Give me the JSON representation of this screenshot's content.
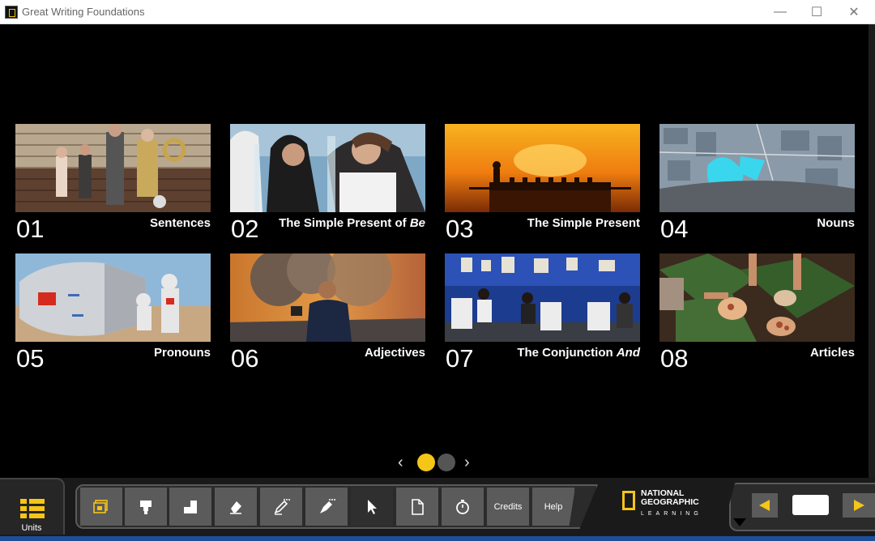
{
  "window": {
    "title": "Great Writing Foundations",
    "minimize_label": "—",
    "maximize_label": "☐",
    "close_label": "✕"
  },
  "units": [
    {
      "number": "01",
      "title": "Sentences",
      "title_italic": ""
    },
    {
      "number": "02",
      "title": "The Simple Present of ",
      "title_italic": "Be"
    },
    {
      "number": "03",
      "title": "The Simple Present",
      "title_italic": ""
    },
    {
      "number": "04",
      "title": "Nouns",
      "title_italic": ""
    },
    {
      "number": "05",
      "title": "Pronouns",
      "title_italic": ""
    },
    {
      "number": "06",
      "title": "Adjectives",
      "title_italic": ""
    },
    {
      "number": "07",
      "title": "The Conjunction ",
      "title_italic": "And"
    },
    {
      "number": "08",
      "title": "Articles",
      "title_italic": ""
    }
  ],
  "pager": {
    "prev": "‹",
    "next": "›",
    "pages": 2,
    "current": 1
  },
  "toolbar": {
    "units_label": "Units",
    "credits_label": "Credits",
    "help_label": "Help",
    "icons": [
      "screens-icon",
      "highlighter-icon",
      "screen-mask-icon",
      "eraser-icon",
      "pencil-icon",
      "pen-icon",
      "pointer-icon",
      "blank-page-icon",
      "timer-icon"
    ]
  },
  "brand": {
    "line1": "NATIONAL",
    "line2": "GEOGRAPHIC",
    "line3": "LEARNING"
  },
  "colors": {
    "accent": "#f5c518",
    "background": "#000000",
    "button": "#5b5b5b"
  }
}
